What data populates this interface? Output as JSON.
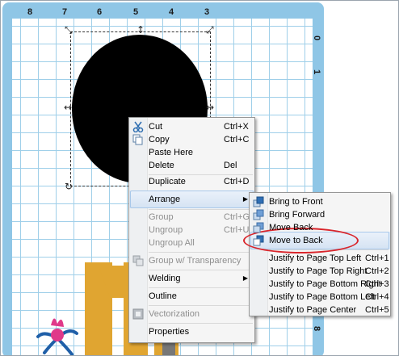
{
  "ruler": {
    "top_labels": [
      "8",
      "7",
      "6",
      "5",
      "4",
      "3"
    ],
    "right_labels": [
      "0",
      "1",
      "8"
    ]
  },
  "context_menu": {
    "items": [
      {
        "label": "Cut",
        "shortcut": "Ctrl+X",
        "icon": "scissors-icon"
      },
      {
        "label": "Copy",
        "shortcut": "Ctrl+C",
        "icon": "copy-icon"
      },
      {
        "label": "Paste Here",
        "shortcut": ""
      },
      {
        "label": "Delete",
        "shortcut": "Del"
      },
      {
        "label": "Duplicate",
        "shortcut": "Ctrl+D"
      },
      {
        "label": "Arrange",
        "shortcut": ""
      },
      {
        "label": "Group",
        "shortcut": "Ctrl+G"
      },
      {
        "label": "Ungroup",
        "shortcut": "Ctrl+U"
      },
      {
        "label": "Ungroup All",
        "shortcut": ""
      },
      {
        "label": "Group w/ Transparency",
        "shortcut": "",
        "icon": "group-transparency-icon"
      },
      {
        "label": "Welding",
        "shortcut": ""
      },
      {
        "label": "Outline",
        "shortcut": ""
      },
      {
        "label": "Vectorization",
        "shortcut": "",
        "icon": "vectorization-icon"
      },
      {
        "label": "Properties",
        "shortcut": ""
      }
    ]
  },
  "arrange_submenu": {
    "items": [
      {
        "label": "Bring to Front",
        "shortcut": "",
        "icon": "bring-to-front-icon"
      },
      {
        "label": "Bring Forward",
        "shortcut": "",
        "icon": "bring-forward-icon"
      },
      {
        "label": "Move Back",
        "shortcut": "",
        "icon": "move-back-icon"
      },
      {
        "label": "Move to Back",
        "shortcut": "",
        "icon": "move-to-back-icon"
      },
      {
        "label": "Justify to Page Top Left",
        "shortcut": "Ctrl+1"
      },
      {
        "label": "Justify to Page Top Right",
        "shortcut": "Ctrl+2"
      },
      {
        "label": "Justify to Page Bottom Right",
        "shortcut": "Ctrl+3"
      },
      {
        "label": "Justify to Page Bottom Left",
        "shortcut": "Ctrl+4"
      },
      {
        "label": "Justify to Page Center",
        "shortcut": "Ctrl+5"
      }
    ]
  },
  "colors": {
    "mat": "#8fc6e6",
    "grid_line": "#9fcfe9",
    "highlight_oval": "#d9262c",
    "art_yellow": "#e0a531",
    "art_pink": "#e0398a",
    "art_blue": "#1f5fa8"
  }
}
